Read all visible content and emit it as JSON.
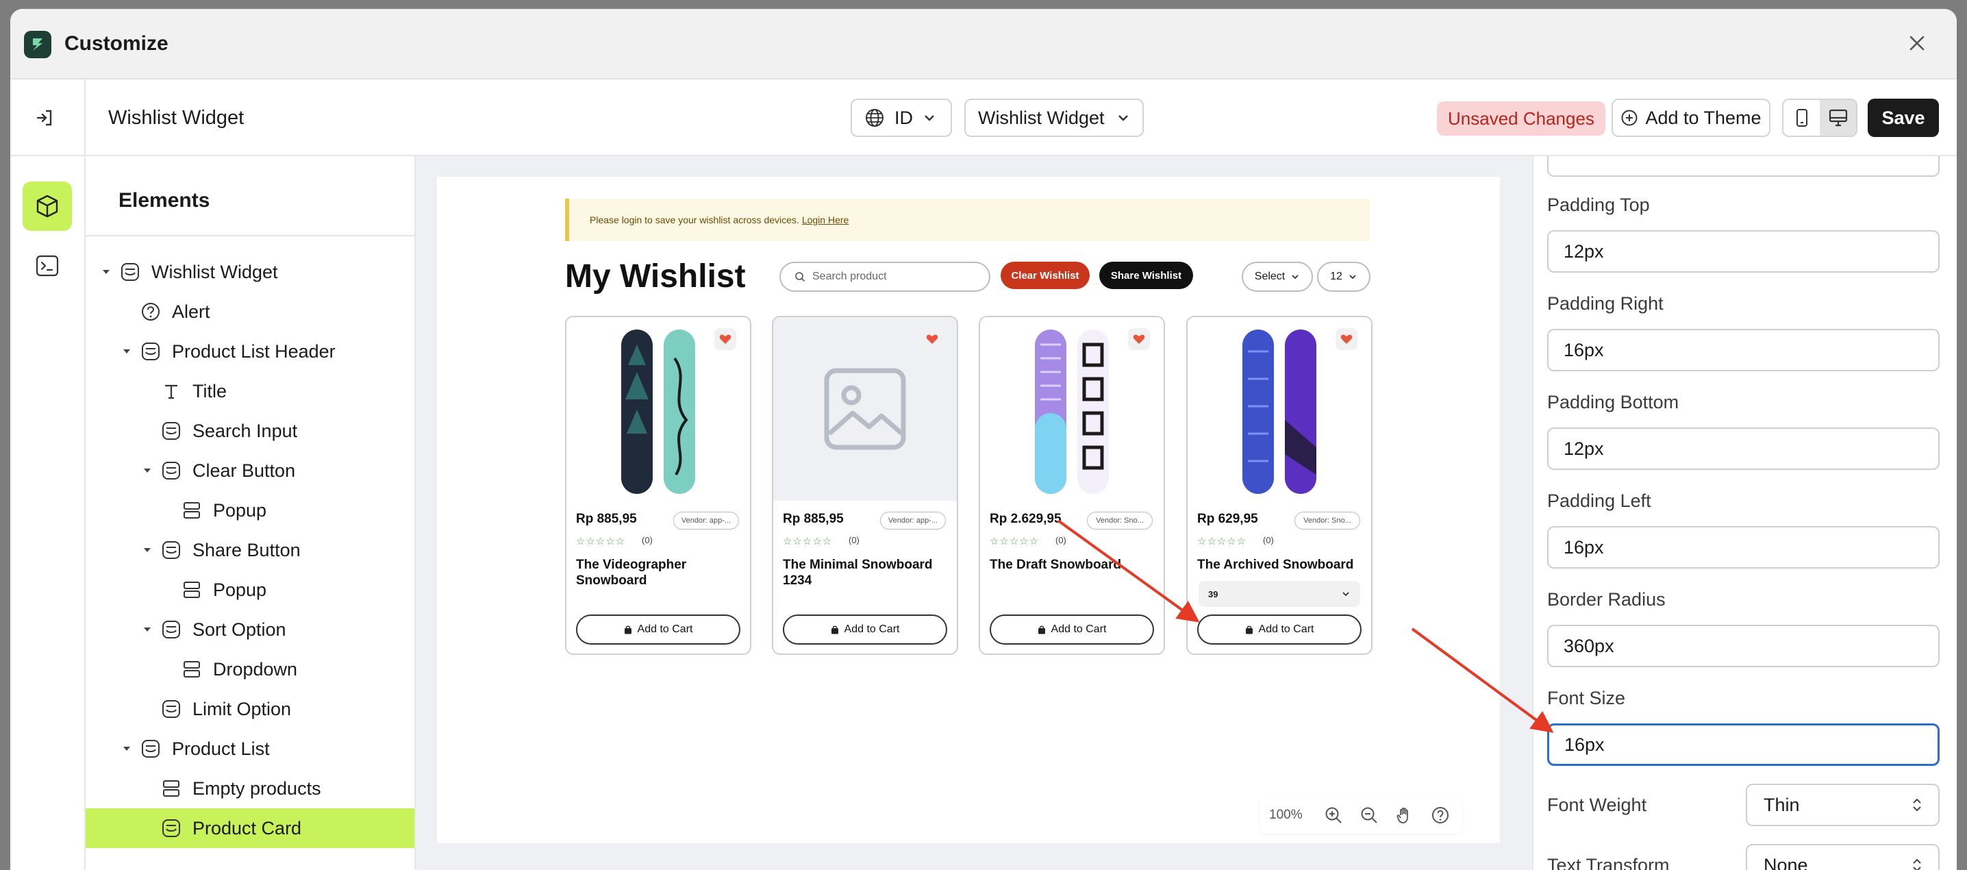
{
  "app": {
    "title": "Customize"
  },
  "topbar": {
    "page_heading": "Wishlist Widget",
    "language": "ID",
    "widget_select": "Wishlist Widget",
    "unsaved": "Unsaved Changes",
    "add_to_theme": "Add to Theme",
    "save": "Save"
  },
  "tree": {
    "heading": "Elements",
    "items": [
      {
        "label": "Wishlist Widget"
      },
      {
        "label": "Alert"
      },
      {
        "label": "Product List Header"
      },
      {
        "label": "Title"
      },
      {
        "label": "Search Input"
      },
      {
        "label": "Clear Button"
      },
      {
        "label": "Popup"
      },
      {
        "label": "Share Button"
      },
      {
        "label": "Popup"
      },
      {
        "label": "Sort Option"
      },
      {
        "label": "Dropdown"
      },
      {
        "label": "Limit Option"
      },
      {
        "label": "Product List"
      },
      {
        "label": "Empty products"
      },
      {
        "label": "Product Card"
      }
    ]
  },
  "preview": {
    "alert_text": "Please login to save your wishlist across devices.",
    "alert_link": "Login Here",
    "title": "My Wishlist",
    "search_placeholder": "Search product",
    "clear_button": "Clear Wishlist",
    "share_button": "Share Wishlist",
    "sort_value": "Select",
    "limit_value": "12",
    "add_to_cart": "Add to Cart",
    "reviews": "(0)",
    "products": [
      {
        "price": "Rp 885,95",
        "vendor": "Vendor: app-...",
        "name": "The Videographer Snowboard"
      },
      {
        "price": "Rp 885,95",
        "vendor": "Vendor: app-...",
        "name": "The Minimal Snowboard 1234"
      },
      {
        "price": "Rp 2.629,95",
        "vendor": "Vendor: Sno...",
        "name": "The Draft Snowboard"
      },
      {
        "price": "Rp 629,95",
        "vendor": "Vendor: Sno...",
        "name": "The Archived Snowboard",
        "variant": "39"
      }
    ],
    "zoom": "100%"
  },
  "props": {
    "fields": [
      {
        "label": "Padding Top",
        "value": "12px"
      },
      {
        "label": "Padding Right",
        "value": "16px"
      },
      {
        "label": "Padding Bottom",
        "value": "12px"
      },
      {
        "label": "Padding Left",
        "value": "16px"
      },
      {
        "label": "Border Radius",
        "value": "360px"
      },
      {
        "label": "Font Size",
        "value": "16px"
      }
    ],
    "font_weight": {
      "label": "Font Weight",
      "value": "Thin"
    },
    "text_transform": {
      "label": "Text Transform",
      "value": "None"
    }
  },
  "colors": {
    "accent": "#c7f25a",
    "annotation": "#e53b26",
    "focus": "#2c6ecb",
    "danger_button": "#c9361c",
    "unsaved_bg": "#fad4d4"
  }
}
